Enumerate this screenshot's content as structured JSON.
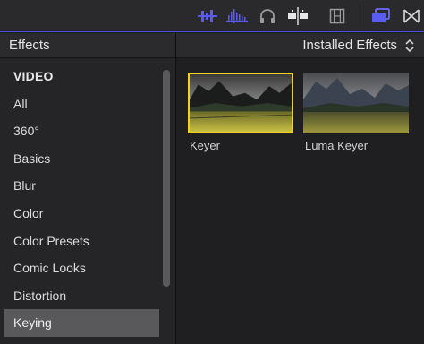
{
  "toolbar": {
    "icons": [
      "audio-waveform-icon",
      "audio-level-icon",
      "headphones-icon",
      "skimmer-icon",
      "filmstrip-icon",
      "browser-window-icon",
      "transitions-icon"
    ],
    "accent_color": "#5a5cf0"
  },
  "effects_panel": {
    "title": "Effects",
    "categories": [
      "VIDEO",
      "All",
      "360°",
      "Basics",
      "Blur",
      "Color",
      "Color Presets",
      "Comic Looks",
      "Distortion",
      "Keying"
    ],
    "selected_category": "Keying"
  },
  "browser": {
    "title": "Installed Effects",
    "items": [
      {
        "label": "Keyer",
        "selected": true
      },
      {
        "label": "Luma Keyer",
        "selected": false
      }
    ],
    "selection_color": "#f6d21f"
  }
}
